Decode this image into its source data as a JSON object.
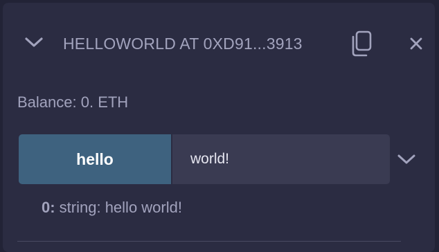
{
  "header": {
    "title": "HELLOWORLD AT 0XD91...3913",
    "icons": {
      "collapse": "chevron-down-icon",
      "copy": "copy-icon",
      "close": "close-icon"
    }
  },
  "balance": {
    "text": "Balance: 0. ETH"
  },
  "function": {
    "button_label": "hello",
    "input_value": "world!",
    "expand_icon": "chevron-down-icon"
  },
  "result": {
    "index": "0:",
    "text": " string: hello world!"
  },
  "colors": {
    "background": "#222336",
    "panel": "#2b2c42",
    "button": "#3e627f",
    "input": "#3a3b52",
    "text_muted": "#a2a3bd"
  }
}
